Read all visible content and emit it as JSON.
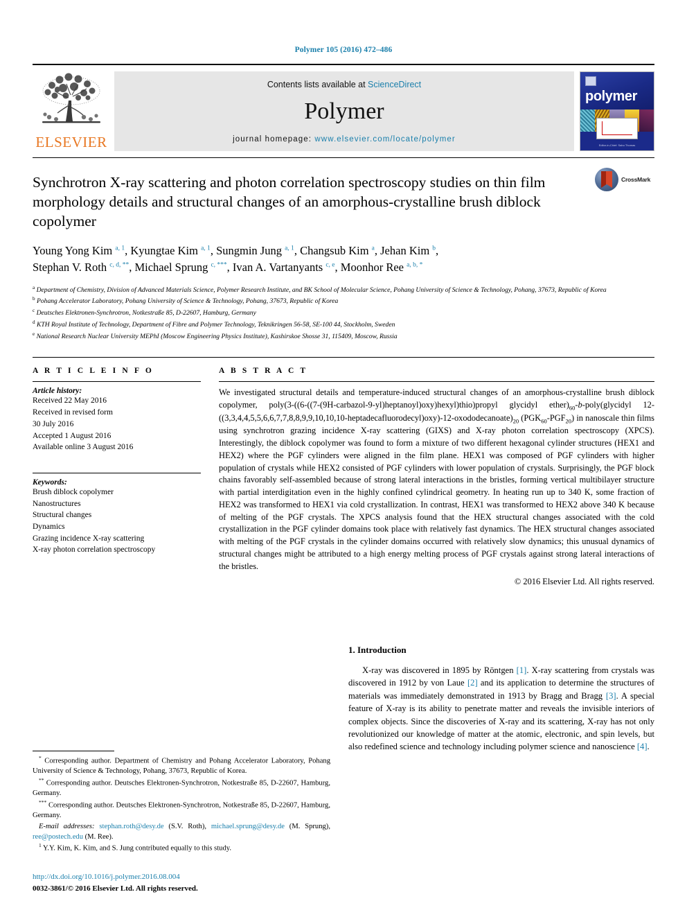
{
  "running_head": "Polymer 105 (2016) 472–486",
  "masthead": {
    "publisher_name": "ELSEVIER",
    "contents_prefix": "Contents lists available at ",
    "contents_link": "ScienceDirect",
    "journal_name": "Polymer",
    "homepage_prefix": "journal homepage: ",
    "homepage_url": "www.elsevier.com/locate/polymer",
    "cover_title": "polymer",
    "cover_footer": "Editor-in-Chief: Sabu Thomas"
  },
  "title": "Synchrotron X-ray scattering and photon correlation spectroscopy studies on thin film morphology details and structural changes of an amorphous-crystalline brush diblock copolymer",
  "crossmark_label": "CrossMark",
  "authors_line1": "Young Yong Kim <sup>a, 1</sup>, Kyungtae Kim <sup>a, 1</sup>, Sungmin Jung <sup>a, 1</sup>, Changsub Kim <sup>a</sup>, Jehan Kim <sup>b</sup>,",
  "authors_line2": "Stephan V. Roth <sup>c, d, **</sup>, Michael Sprung <sup>c, ***</sup>, Ivan A. Vartanyants <sup>c, e</sup>, Moonhor Ree <sup>a, b, *</sup>",
  "affiliations": [
    "<sup>a</sup> Department of Chemistry, Division of Advanced Materials Science, Polymer Research Institute, and BK School of Molecular Science, Pohang University of Science &amp; Technology, Pohang, 37673, Republic of Korea",
    "<sup>b</sup> Pohang Accelerator Laboratory, Pohang University of Science &amp; Technology, Pohang, 37673, Republic of Korea",
    "<sup>c</sup> Deutsches Elektronen-Synchrotron, Notkestraße 85, D-22607, Hamburg, Germany",
    "<sup>d</sup> KTH Royal Institute of Technology, Department of Fibre and Polymer Technology, Teknikringen 56-58, SE-100 44, Stockholm, Sweden",
    "<sup>e</sup> National Research Nuclear University MEPhI (Moscow Engineering Physics Institute), Kashirskoe Shosse 31, 115409, Moscow, Russia"
  ],
  "article_info": {
    "heading": "A R T I C L E    I N F O",
    "history_label": "Article history:",
    "history": [
      "Received 22 May 2016",
      "Received in revised form",
      "30 July 2016",
      "Accepted 1 August 2016",
      "Available online 3 August 2016"
    ],
    "keywords_label": "Keywords:",
    "keywords": [
      "Brush diblock copolymer",
      "Nanostructures",
      "Structural changes",
      "Dynamics",
      "Grazing incidence X-ray scattering",
      "X-ray photon correlation spectroscopy"
    ]
  },
  "abstract": {
    "heading": "A B S T R A C T",
    "text": "We investigated structural details and temperature-induced structural changes of an amorphous-crystalline brush diblock copolymer, poly(3-((6-((7-(9H-carbazol-9-yl)heptanoyl)oxy)hexyl)thio)propyl glycidyl ether)<sub>60</sub>-<i>b</i>-poly(glycidyl 12-((3,3,4,4,5,5,6,6,7,7,8,8,9,9,10,10,10-heptadecafluorodecyl)oxy)-12-oxododecanoate)<sub>20</sub> (PGK<sub>60</sub>-PGF<sub>20</sub>) in nanoscale thin films using synchrotron grazing incidence X-ray scattering (GIXS) and X-ray photon correlation spectroscopy (XPCS). Interestingly, the diblock copolymer was found to form a mixture of two different hexagonal cylinder structures (HEX1 and HEX2) where the PGF cylinders were aligned in the film plane. HEX1 was composed of PGF cylinders with higher population of crystals while HEX2 consisted of PGF cylinders with lower population of crystals. Surprisingly, the PGF block chains favorably self-assembled because of strong lateral interactions in the bristles, forming vertical multibilayer structure with partial interdigitation even in the highly confined cylindrical geometry. In heating run up to 340 K, some fraction of HEX2 was transformed to HEX1 via cold crystallization. In contrast, HEX1 was transformed to HEX2 above 340 K because of melting of the PGF crystals. The XPCS analysis found that the HEX structural changes associated with the cold crystallization in the PGF cylinder domains took place with relatively fast dynamics. The HEX structural changes associated with melting of the PGF crystals in the cylinder domains occurred with relatively slow dynamics; this unusual dynamics of structural changes might be attributed to a high energy melting process of PGF crystals against strong lateral interactions of the bristles.",
    "copyright": "© 2016 Elsevier Ltd. All rights reserved."
  },
  "introduction": {
    "heading": "1. Introduction",
    "paragraph": "X-ray was discovered in 1895 by Röntgen <span class=\"ref\">[1]</span>. X-ray scattering from crystals was discovered in 1912 by von Laue <span class=\"ref\">[2]</span> and its application to determine the structures of materials was immediately demonstrated in 1913 by Bragg and Bragg <span class=\"ref\">[3]</span>. A special feature of X-ray is its ability to penetrate matter and reveals the invisible interiors of complex objects. Since the discoveries of X-ray and its scattering, X-ray has not only revolutionized our knowledge of matter at the atomic, electronic, and spin levels, but also redefined science and technology including polymer science and nanoscience <span class=\"ref\">[4]</span>."
  },
  "footnotes": [
    "<sup>*</sup> Corresponding author. Department of Chemistry and Pohang Accelerator Laboratory, Pohang University of Science &amp; Technology, Pohang, 37673, Republic of Korea.",
    "<sup>**</sup> Corresponding author. Deutsches Elektronen-Synchrotron, Notkestraße 85, D-22607, Hamburg, Germany.",
    "<sup>***</sup> Corresponding author. Deutsches Elektronen-Synchrotron, Notkestraße 85, D-22607, Hamburg, Germany.",
    "<i>E-mail addresses:</i> <span class=\"lnk\">stephan.roth@desy.de</span> (S.V. Roth), <span class=\"lnk\">michael.sprung@desy.de</span> (M. Sprung), <span class=\"lnk\">ree@postech.edu</span> (M. Ree).",
    "<sup>1</sup> Y.Y. Kim, K. Kim, and S. Jung contributed equally to this study."
  ],
  "doi": "http://dx.doi.org/10.1016/j.polymer.2016.08.004",
  "issn_line": "0032-3861/© 2016 Elsevier Ltd. All rights reserved.",
  "colors": {
    "link": "#1a7fab",
    "elsevier_orange": "#E87722",
    "masthead_grey": "#e6e6e6",
    "cover_blue": "#1b2a8a"
  }
}
